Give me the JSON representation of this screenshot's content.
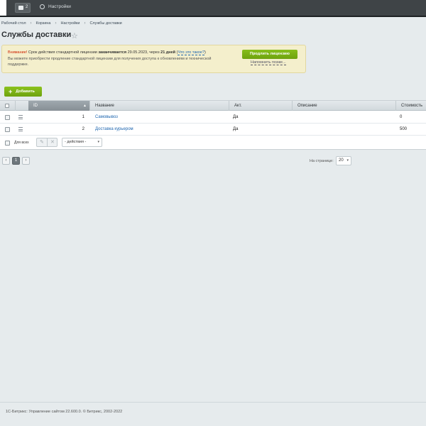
{
  "topbar": {
    "counter": "2",
    "settings_label": "Настройки"
  },
  "breadcrumb": [
    "Рабочий стол",
    "Корзина",
    "Настройки",
    "Службы доставки"
  ],
  "page": {
    "title": "Службы доставки"
  },
  "notice": {
    "warning_label": "Внимание!",
    "text_before_date": " Срок действия стандартной лицензии ",
    "expires": "заканчивается",
    "date_text": " 29.05.2023, через ",
    "days": "21 дней",
    "link": "Что это такое?",
    "line2": "Вы можете приобрести продление стандартной лицензии для получения доступа к обновлениям и технической поддержке.",
    "renew_button": "Продлить лицензию",
    "remind_link": "Напомнить позже..."
  },
  "toolbar": {
    "add_label": "Добавить"
  },
  "table": {
    "columns": [
      "ID",
      "Название",
      "Акт.",
      "Описание",
      "Стоимость"
    ],
    "rows": [
      {
        "id": "1",
        "name": "Самовывоз",
        "active": "Да",
        "description": "",
        "cost": "0"
      },
      {
        "id": "2",
        "name": "Доставка курьером",
        "active": "Да",
        "description": "",
        "cost": "500"
      }
    ],
    "for_all_label": "Для всех",
    "actions_select": "- действия -"
  },
  "pager": {
    "current_page": "1",
    "per_page_label": "На странице:",
    "per_page_value": "20"
  },
  "footer": {
    "copyright": "1С-Битрикс: Управление сайтом 22.600.0. © Битрикс, 2002-2022"
  },
  "colors": {
    "accent_green": "#6ea20e",
    "link_blue": "#2067b0",
    "warning_red": "#cc2200",
    "topbar": "#3f4447"
  },
  "icons": [
    "notifications-icon",
    "gear-icon",
    "star-icon",
    "plus-icon",
    "menu-icon",
    "edit-icon",
    "delete-icon",
    "chevron-left-icon",
    "chevron-right-icon"
  ]
}
